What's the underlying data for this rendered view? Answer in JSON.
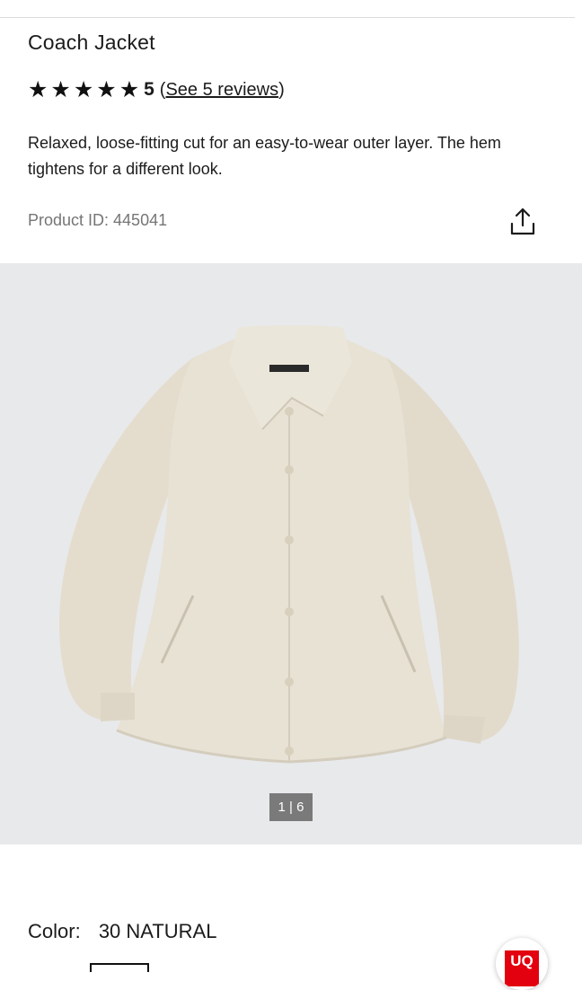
{
  "product": {
    "title": "Coach Jacket",
    "rating": {
      "stars_filled": 5,
      "stars_total": 5,
      "value": "5",
      "open_paren": "(",
      "reviews_link": "See 5 reviews",
      "close_paren": ")"
    },
    "description": "Relaxed, loose-fitting cut for an easy-to-wear outer layer. The hem tightens for a different look.",
    "product_id": "Product ID: 445041"
  },
  "gallery": {
    "counter": "1 | 6",
    "current_image": 1,
    "total_images": 6
  },
  "color": {
    "label": "Color:",
    "value": "30 NATURAL"
  },
  "brand_logo": {
    "text": "UQ",
    "color": "#e3000f"
  },
  "icons": {
    "star": "star-icon",
    "share": "share-icon"
  },
  "colors": {
    "text": "#1b1b1b",
    "muted": "#757575",
    "gallery_bg": "#e8e9eb",
    "jacket": "#e6e0d3",
    "counter_bg": "#7a7a7a"
  }
}
